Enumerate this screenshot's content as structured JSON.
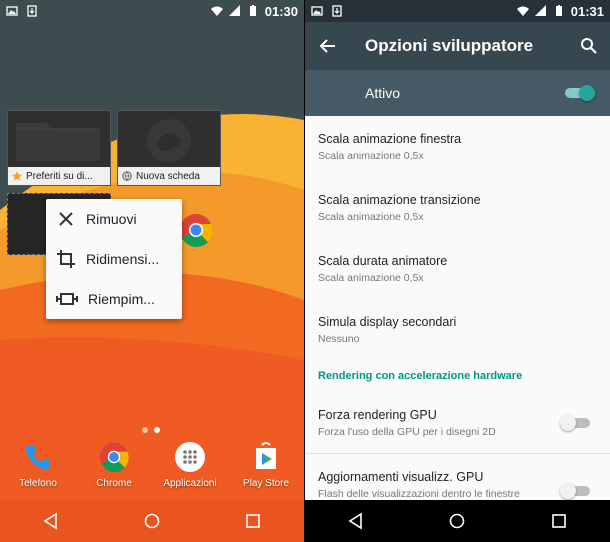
{
  "left": {
    "status": {
      "time": "01:30"
    },
    "widgets": [
      {
        "label": "Preferiti su di..."
      },
      {
        "label": "Nuova scheda"
      }
    ],
    "menu": {
      "items": [
        "Rimuovi",
        "Ridimensi...",
        "Riempim..."
      ]
    },
    "dock": [
      {
        "name": "Telefono"
      },
      {
        "name": "Chrome"
      },
      {
        "name": "Applicazioni"
      },
      {
        "name": "Play Store"
      }
    ]
  },
  "right": {
    "status": {
      "time": "01:31"
    },
    "title": "Opzioni sviluppatore",
    "master_label": "Attivo",
    "rows": [
      {
        "title": "Scala animazione finestra",
        "sub": "Scala animazione 0,5x"
      },
      {
        "title": "Scala animazione transizione",
        "sub": "Scala animazione 0,5x"
      },
      {
        "title": "Scala durata animatore",
        "sub": "Scala animazione 0,5x"
      },
      {
        "title": "Simula display secondari",
        "sub": "Nessuno"
      }
    ],
    "section": "Rendering con accelerazione hardware",
    "toggle_rows": [
      {
        "title": "Forza rendering GPU",
        "sub": "Forza l'uso della GPU per i disegni 2D"
      },
      {
        "title": "Aggiornamenti visualizz. GPU",
        "sub": "Flash delle visualizzazioni dentro le finestre"
      }
    ]
  },
  "colors": {
    "accent": "#80cbc4",
    "accent_knob": "#26a69a",
    "appbar": "#37474f",
    "section": "#009688",
    "wall_orange": "#f26a21",
    "wall_yellow": "#f9b233"
  }
}
